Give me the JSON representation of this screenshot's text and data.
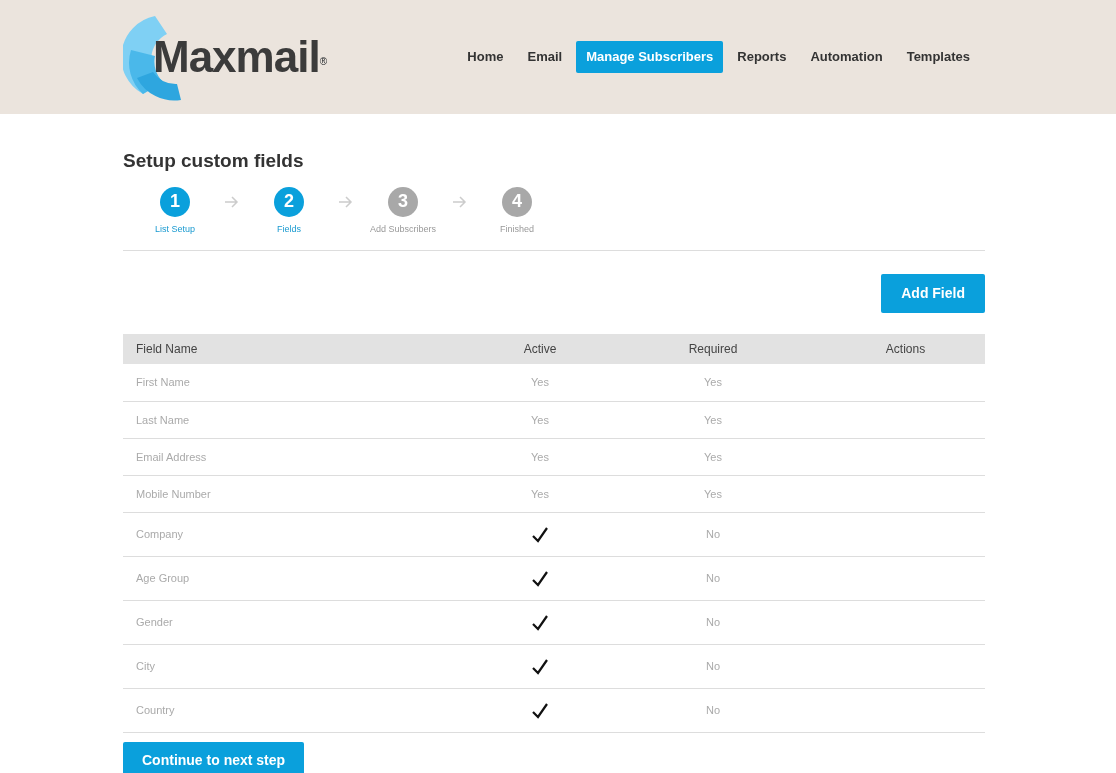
{
  "brand": {
    "name": "Maxmail",
    "mark": "®"
  },
  "nav": [
    {
      "label": "Home",
      "selected": false
    },
    {
      "label": "Email",
      "selected": false
    },
    {
      "label": "Manage Subscribers",
      "selected": true
    },
    {
      "label": "Reports",
      "selected": false
    },
    {
      "label": "Automation",
      "selected": false
    },
    {
      "label": "Templates",
      "selected": false
    }
  ],
  "title": "Setup custom fields",
  "steps": [
    {
      "number": "1",
      "label": "List Setup",
      "done": true
    },
    {
      "number": "2",
      "label": "Fields",
      "done": true
    },
    {
      "number": "3",
      "label": "Add Subscribers",
      "done": false
    },
    {
      "number": "4",
      "label": "Finished",
      "done": false
    }
  ],
  "add_button": "Add Field",
  "table": {
    "columns": [
      "Field Name",
      "Active",
      "Required",
      "Actions"
    ],
    "rows": [
      {
        "name": "First Name",
        "active": {
          "kind": "text",
          "text": "Yes"
        },
        "required": "Yes"
      },
      {
        "name": "Last Name",
        "active": {
          "kind": "text",
          "text": "Yes"
        },
        "required": "Yes"
      },
      {
        "name": "Email Address",
        "active": {
          "kind": "text",
          "text": "Yes"
        },
        "required": "Yes"
      },
      {
        "name": "Mobile Number",
        "active": {
          "kind": "text",
          "text": "Yes"
        },
        "required": "Yes"
      },
      {
        "name": "Company",
        "active": {
          "kind": "checkbox",
          "checked": true
        },
        "required": "No"
      },
      {
        "name": "Age Group",
        "active": {
          "kind": "checkbox",
          "checked": true
        },
        "required": "No"
      },
      {
        "name": "Gender",
        "active": {
          "kind": "checkbox",
          "checked": true
        },
        "required": "No"
      },
      {
        "name": "City",
        "active": {
          "kind": "checkbox",
          "checked": true
        },
        "required": "No"
      },
      {
        "name": "Country",
        "active": {
          "kind": "checkbox",
          "checked": true
        },
        "required": "No"
      }
    ]
  },
  "continue_button": "Continue to next step"
}
